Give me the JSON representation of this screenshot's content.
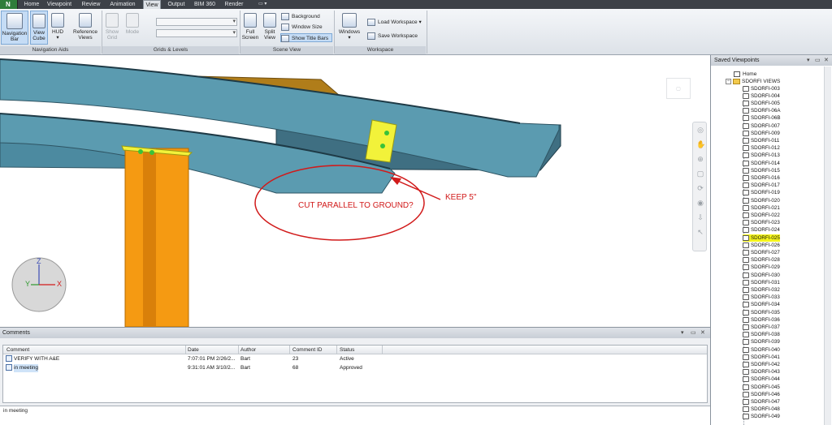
{
  "menu": {
    "logo": "N",
    "tabs": [
      "Home",
      "Viewpoint",
      "Review",
      "Animation",
      "View",
      "Output",
      "BIM 360",
      "Render"
    ],
    "active_tab": "View"
  },
  "ribbon": {
    "navigation_aids": {
      "title": "Navigation Aids",
      "navigation_bar": "Navigation Bar",
      "view_cube": "View Cube",
      "hud": "HUD",
      "reference_views": "Reference Views"
    },
    "grids_levels": {
      "title": "Grids & Levels",
      "show_grid": "Show Grid",
      "mode": "Mode"
    },
    "scene_view": {
      "title": "Scene View",
      "full_screen": "Full Screen",
      "split_view": "Split View",
      "background": "Background",
      "window_size": "Window Size",
      "show_title_bars": "Show Title Bars"
    },
    "workspace": {
      "title": "Workspace",
      "windows": "Windows",
      "load_workspace": "Load Workspace",
      "save_workspace": "Save Workspace"
    }
  },
  "viewport": {
    "annotation_main": "CUT PARALLEL TO GROUND?",
    "annotation_keep": "KEEP 5\"",
    "axis_z": "Z",
    "axis_y": "Y",
    "axis_x": "X",
    "colors": {
      "beam": "#5b9bb0",
      "beam_dark": "#2e5463",
      "column": "#f59a12",
      "plate": "#f2f23a",
      "markup": "#d11a1a"
    }
  },
  "comments": {
    "title": "Comments",
    "columns": [
      "Comment",
      "Date",
      "Author",
      "Comment ID",
      "Status"
    ],
    "rows": [
      {
        "comment": "VERIFY WITH A&E",
        "date": "7:07:01 PM 2/26/2...",
        "author": "Bart",
        "id": "23",
        "status": "Active"
      },
      {
        "comment": "in meeting",
        "date": "9:31:01 AM 3/10/2...",
        "author": "Bart",
        "id": "68",
        "status": "Approved"
      }
    ],
    "current_text": "in meeting"
  },
  "saved_viewpoints": {
    "title": "Saved Viewpoints",
    "home": "Home",
    "folder": "SDORFI VIEWS",
    "highlighted": "SDORFI-025",
    "items": [
      "SDORFI-003",
      "SDORFI-004",
      "SDORFI-005",
      "SDORFI-06A",
      "SDORFI-06B",
      "SDORFI-007",
      "SDORFI-009",
      "SDORFI-011",
      "SDORFI-012",
      "SDORFI-013",
      "SDORFI-014",
      "SDORFI-015",
      "SDORFI-016",
      "SDORFI-017",
      "SDORFI-019",
      "SDORFI-020",
      "SDORFI-021",
      "SDORFI-022",
      "SDORFI-023",
      "SDORFI-024",
      "SDORFI-025",
      "SDORFI-026",
      "SDORFI-027",
      "SDORFI-028",
      "SDORFI-029",
      "SDORFI-030",
      "SDORFI-031",
      "SDORFI-032",
      "SDORFI-033",
      "SDORFI-034",
      "SDORFI-035",
      "SDORFI-036",
      "SDORFI-037",
      "SDORFI-038",
      "SDORFI-039",
      "SDORFI-040",
      "SDORFI-041",
      "SDORFI-042",
      "SDORFI-043",
      "SDORFI-044",
      "SDORFI-045",
      "SDORFI-046",
      "SDORFI-047",
      "SDORFI-048",
      "SDORFI-049"
    ]
  }
}
